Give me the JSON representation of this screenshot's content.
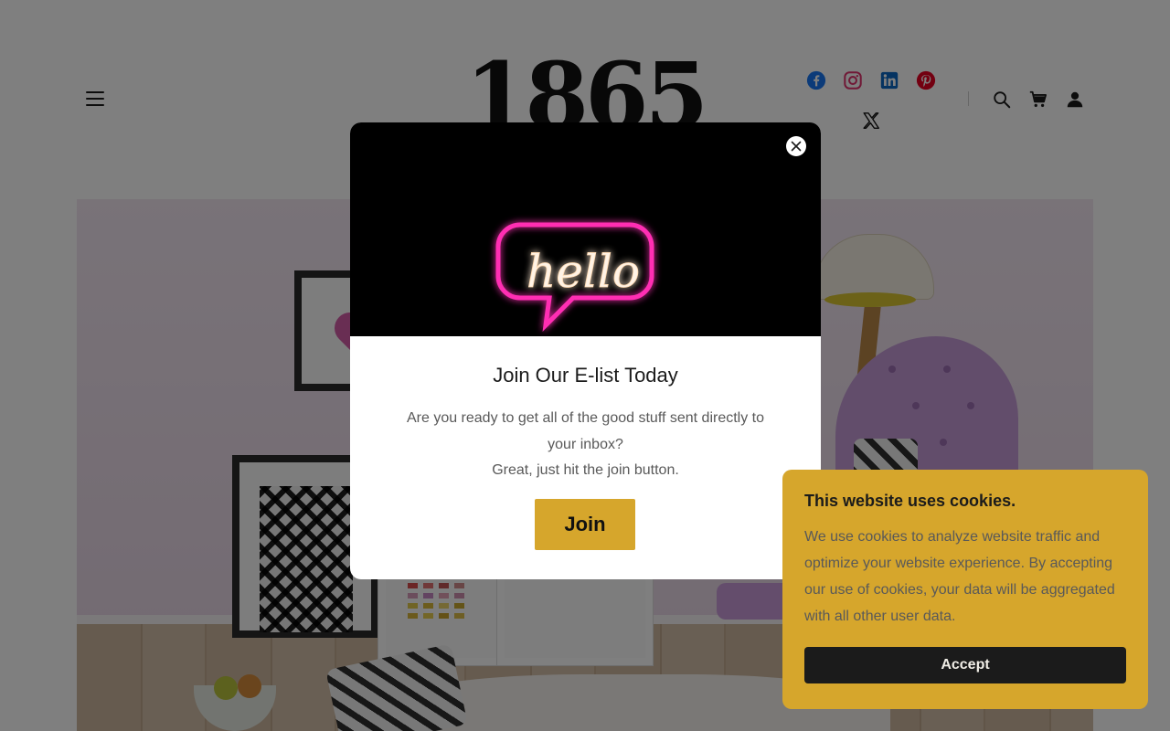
{
  "header": {
    "logo_text": "1865",
    "menu_icon": "hamburger-menu-icon",
    "social_icons": [
      "facebook-icon",
      "instagram-icon",
      "linkedin-icon",
      "pinterest-icon",
      "x-twitter-icon"
    ],
    "utility_icons": [
      "search-icon",
      "cart-icon",
      "account-icon"
    ],
    "colors": {
      "facebook": "#1877f2",
      "instagram": "#e1306c",
      "linkedin": "#0a66c2",
      "pinterest": "#e60023",
      "x": "#000000"
    }
  },
  "popup": {
    "image_text": "hello",
    "title": "Join Our E-list Today",
    "body_line1": "Are you ready to get all of the good stuff sent directly to your inbox?",
    "body_line2": "Great, just hit the join button.",
    "join_label": "Join",
    "close_icon": "close-icon",
    "accent_color": "#d6a62c"
  },
  "cookie_banner": {
    "title": "This website uses cookies.",
    "text": "We use cookies to analyze website traffic and optimize your website experience. By accepting our use of cookies, your data will be aggregated with all other user data.",
    "accept_label": "Accept",
    "background_color": "#d6a62c"
  }
}
